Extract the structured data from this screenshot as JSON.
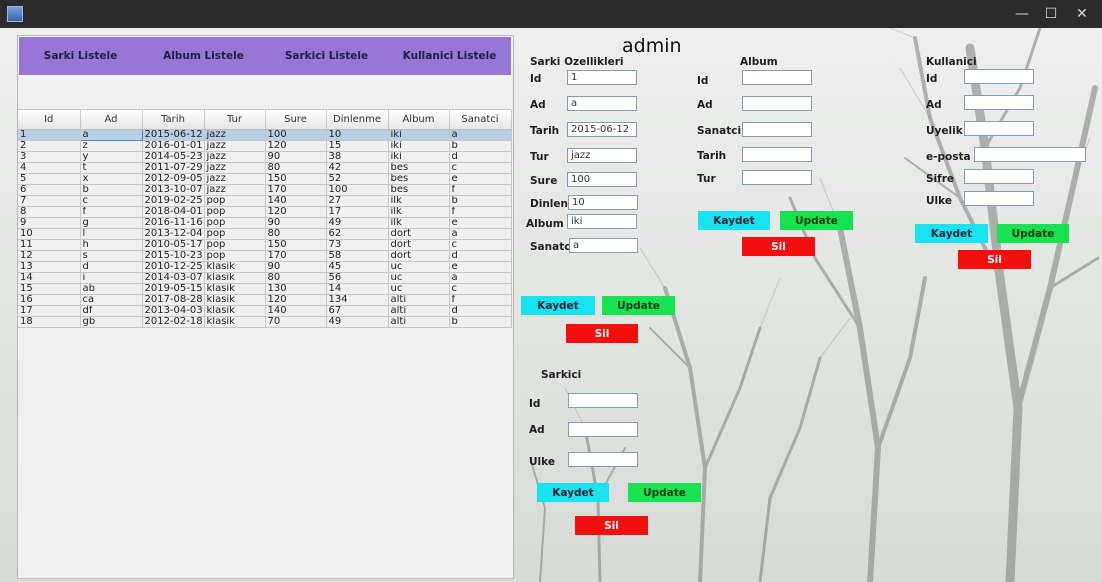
{
  "window": {
    "minimize": "—",
    "maximize": "☐",
    "close": "✕"
  },
  "nav": [
    "Sarki Listele",
    "Album Listele",
    "Sarkici Listele",
    "Kullanici Listele"
  ],
  "table": {
    "columns": [
      "Id",
      "Ad",
      "Tarih",
      "Tur",
      "Sure",
      "Dinlenme",
      "Album",
      "Sanatci"
    ],
    "rows": [
      [
        "1",
        "a",
        "2015-06-12",
        "jazz",
        "100",
        "10",
        "iki",
        "a"
      ],
      [
        "2",
        "z",
        "2016-01-01",
        "jazz",
        "120",
        "15",
        "iki",
        "b"
      ],
      [
        "3",
        "y",
        "2014-05-23",
        "jazz",
        "90",
        "38",
        "iki",
        "d"
      ],
      [
        "4",
        "t",
        "2011-07-29",
        "jazz",
        "80",
        "42",
        "bes",
        "c"
      ],
      [
        "5",
        "x",
        "2012-09-05",
        "jazz",
        "150",
        "52",
        "bes",
        "e"
      ],
      [
        "6",
        "b",
        "2013-10-07",
        "jazz",
        "170",
        "100",
        "bes",
        "f"
      ],
      [
        "7",
        "c",
        "2019-02-25",
        "pop",
        "140",
        "27",
        "ilk",
        "b"
      ],
      [
        "8",
        "f",
        "2018-04-01",
        "pop",
        "120",
        "17",
        "ilk",
        "f"
      ],
      [
        "9",
        "g",
        "2016-11-16",
        "pop",
        "90",
        "49",
        "ilk",
        "e"
      ],
      [
        "10",
        "l",
        "2013-12-04",
        "pop",
        "80",
        "62",
        "dort",
        "a"
      ],
      [
        "11",
        "h",
        "2010-05-17",
        "pop",
        "150",
        "73",
        "dort",
        "c"
      ],
      [
        "12",
        "s",
        "2015-10-23",
        "pop",
        "170",
        "58",
        "dort",
        "d"
      ],
      [
        "13",
        "d",
        "2010-12-25",
        "klasik",
        "90",
        "45",
        "uc",
        "e"
      ],
      [
        "14",
        "i",
        "2014-03-07",
        "klasik",
        "80",
        "56",
        "uc",
        "a"
      ],
      [
        "15",
        "ab",
        "2019-05-15",
        "klasik",
        "130",
        "14",
        "uc",
        "c"
      ],
      [
        "16",
        "ca",
        "2017-08-28",
        "klasik",
        "120",
        "134",
        "alti",
        "f"
      ],
      [
        "17",
        "df",
        "2013-04-03",
        "klasik",
        "140",
        "67",
        "alti",
        "d"
      ],
      [
        "18",
        "gb",
        "2012-02-18",
        "klasik",
        "70",
        "49",
        "alti",
        "b"
      ]
    ]
  },
  "admin": "admin",
  "sarki": {
    "title": "Sarki Ozellikleri",
    "labels": {
      "id": "Id",
      "ad": "Ad",
      "tarih": "Tarih",
      "tur": "Tur",
      "sure": "Sure",
      "dinlenme": "Dinlen...",
      "album": "Album",
      "sanatci": "Sanatci"
    },
    "values": {
      "id": "1",
      "ad": "a",
      "tarih": "2015-06-12",
      "tur": "jazz",
      "sure": "100",
      "dinlenme": "10",
      "album": "iki",
      "sanatci": "a"
    }
  },
  "album": {
    "title": "Album",
    "labels": {
      "id": "Id",
      "ad": "Ad",
      "sanatci": "Sanatci",
      "tarih": "Tarih",
      "tur": "Tur"
    }
  },
  "kullanici": {
    "title": "Kullanici",
    "labels": {
      "id": "Id",
      "ad": "Ad",
      "uyelik": "Uyelik",
      "eposta": "e-posta",
      "sifre": "Sifre",
      "ulke": "Ulke"
    }
  },
  "sarkici": {
    "title": "Sarkici",
    "labels": {
      "id": "Id",
      "ad": "Ad",
      "ulke": "Ulke"
    }
  },
  "buttons": {
    "kaydet": "Kaydet",
    "update": "Update",
    "sil": "Sil"
  },
  "colors": {
    "nav": "#9777d6",
    "kaydet": "#17e3f1",
    "update": "#16e34f",
    "sil": "#f40f0f",
    "selection": "#b8cfe5"
  }
}
